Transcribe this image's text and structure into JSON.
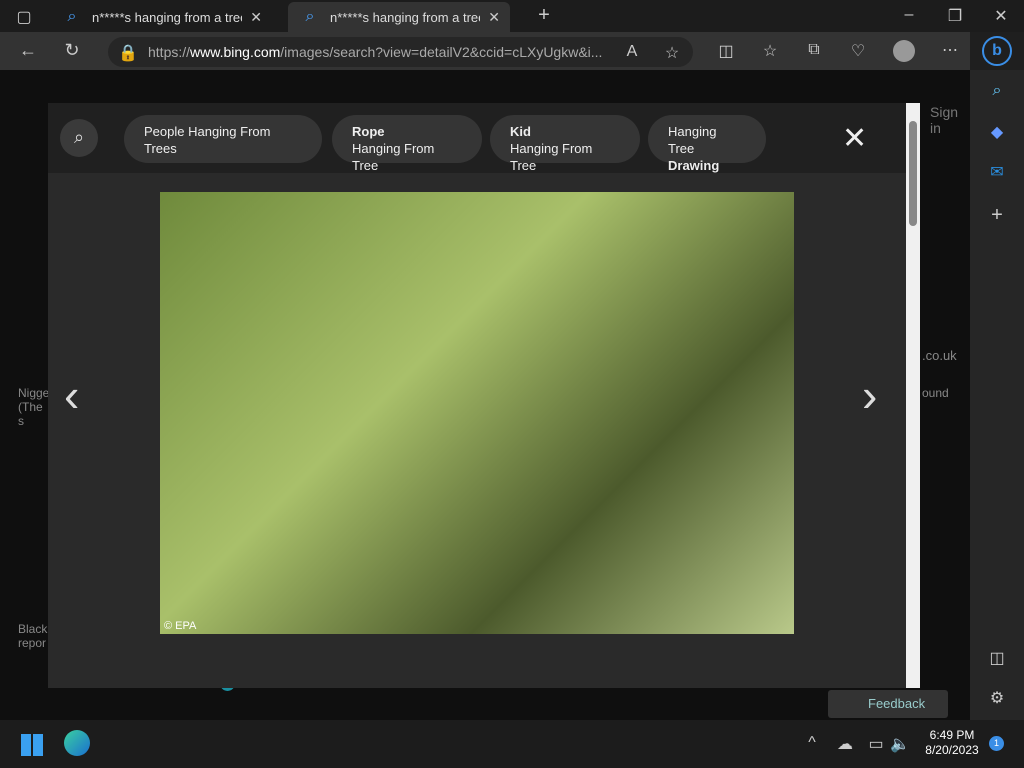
{
  "tabs": [
    {
      "title": "n*****s hanging from a tree - Se",
      "active": false
    },
    {
      "title": "n*****s hanging from a tree - Bi",
      "active": true
    }
  ],
  "address": {
    "prefix": "https://",
    "domain": "www.bing.com",
    "path": "/images/search?view=detailV2&ccid=cLXyUgkw&i..."
  },
  "page": {
    "sign_in": "Sign in",
    "feedback": "Feedback",
    "badge": "1",
    "left_caption_1": "Nigge (The s",
    "left_caption_2": "Black repor",
    "right_caption_1": ".co.uk",
    "right_caption_2": "ound"
  },
  "modal": {
    "chips": [
      {
        "bold": "",
        "text": "People Hanging From Trees"
      },
      {
        "bold": "Rope",
        "text": "Hanging From Tree"
      },
      {
        "bold": "Kid",
        "text": "Hanging From Tree"
      },
      {
        "bold": "Drawing",
        "text": "Hanging Tree",
        "bold_last": true
      }
    ],
    "photo_credit": "© EPA"
  },
  "taskbar": {
    "time": "6:49 PM",
    "date": "8/20/2023",
    "notifications": "1"
  }
}
